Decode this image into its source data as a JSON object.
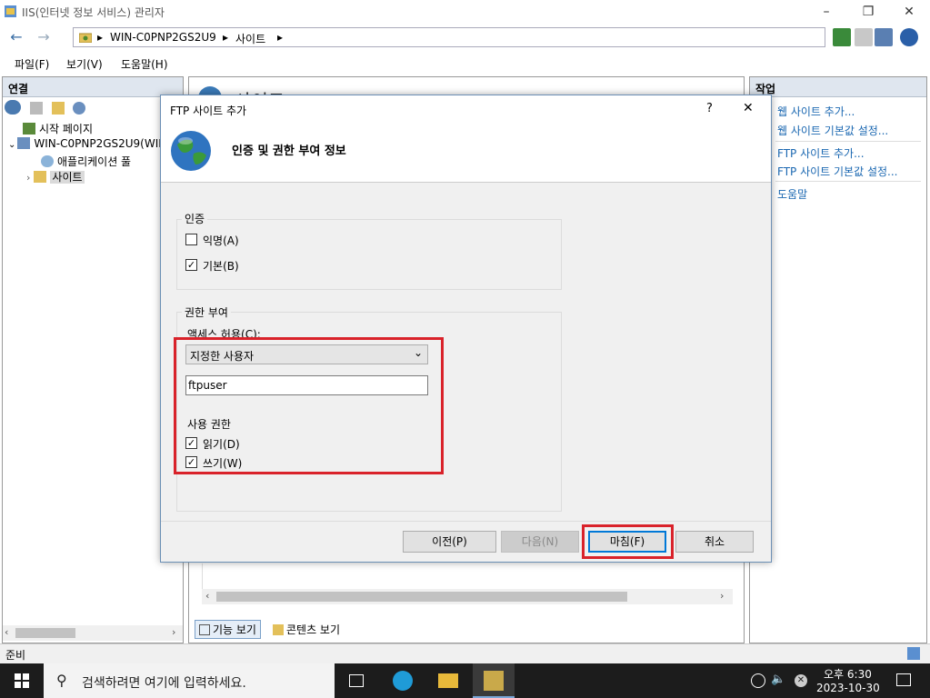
{
  "window": {
    "title": "IIS(인터넷 정보 서비스) 관리자"
  },
  "address": {
    "segments": [
      "WIN-C0PNP2GS2U9",
      "사이트"
    ]
  },
  "menu": [
    "파일(F)",
    "보기(V)",
    "도움말(H)"
  ],
  "left": {
    "header": "연결",
    "tree": [
      {
        "label": "시작 페이지",
        "icon": "start-page-icon"
      },
      {
        "label": "WIN-C0PNP2GS2U9(WIN",
        "icon": "server-icon"
      },
      {
        "label": "애플리케이션 풀",
        "icon": "app-pool-icon"
      },
      {
        "label": "사이트",
        "icon": "sites-folder-icon"
      }
    ]
  },
  "center": {
    "title_partial": "사이트",
    "tabs": [
      "기능 보기",
      "콘텐츠 보기"
    ]
  },
  "right": {
    "header": "작업",
    "actions": [
      "웹 사이트 추가...",
      "웹 사이트 기본값 설정...",
      "FTP 사이트 추가...",
      "FTP 사이트 기본값 설정...",
      "도움말"
    ]
  },
  "status": {
    "text": "준비"
  },
  "dialog": {
    "title": "FTP 사이트 추가",
    "help": "?",
    "close": "✕",
    "heading": "인증 및 권한 부여 정보",
    "auth": {
      "label": "인증",
      "anonymous": {
        "label": "익명(A)",
        "checked": false
      },
      "basic": {
        "label": "기본(B)",
        "checked": true
      }
    },
    "authorization": {
      "label": "권한 부여",
      "access_label": "액세스 허용(C):",
      "access_value": "지정한 사용자",
      "user_value": "ftpuser",
      "perm_label": "사용 권한",
      "read": {
        "label": "읽기(D)",
        "checked": true
      },
      "write": {
        "label": "쓰기(W)",
        "checked": true
      }
    },
    "buttons": {
      "prev": "이전(P)",
      "next": "다음(N)",
      "finish": "마침(F)",
      "cancel": "취소"
    }
  },
  "taskbar": {
    "search_placeholder": "검색하려면 여기에 입력하세요.",
    "time": "오후 6:30",
    "date": "2023-10-30"
  },
  "colors": {
    "highlight": "#d9222a",
    "link": "#1a67b1",
    "pane_header": "#dfe6ef"
  }
}
